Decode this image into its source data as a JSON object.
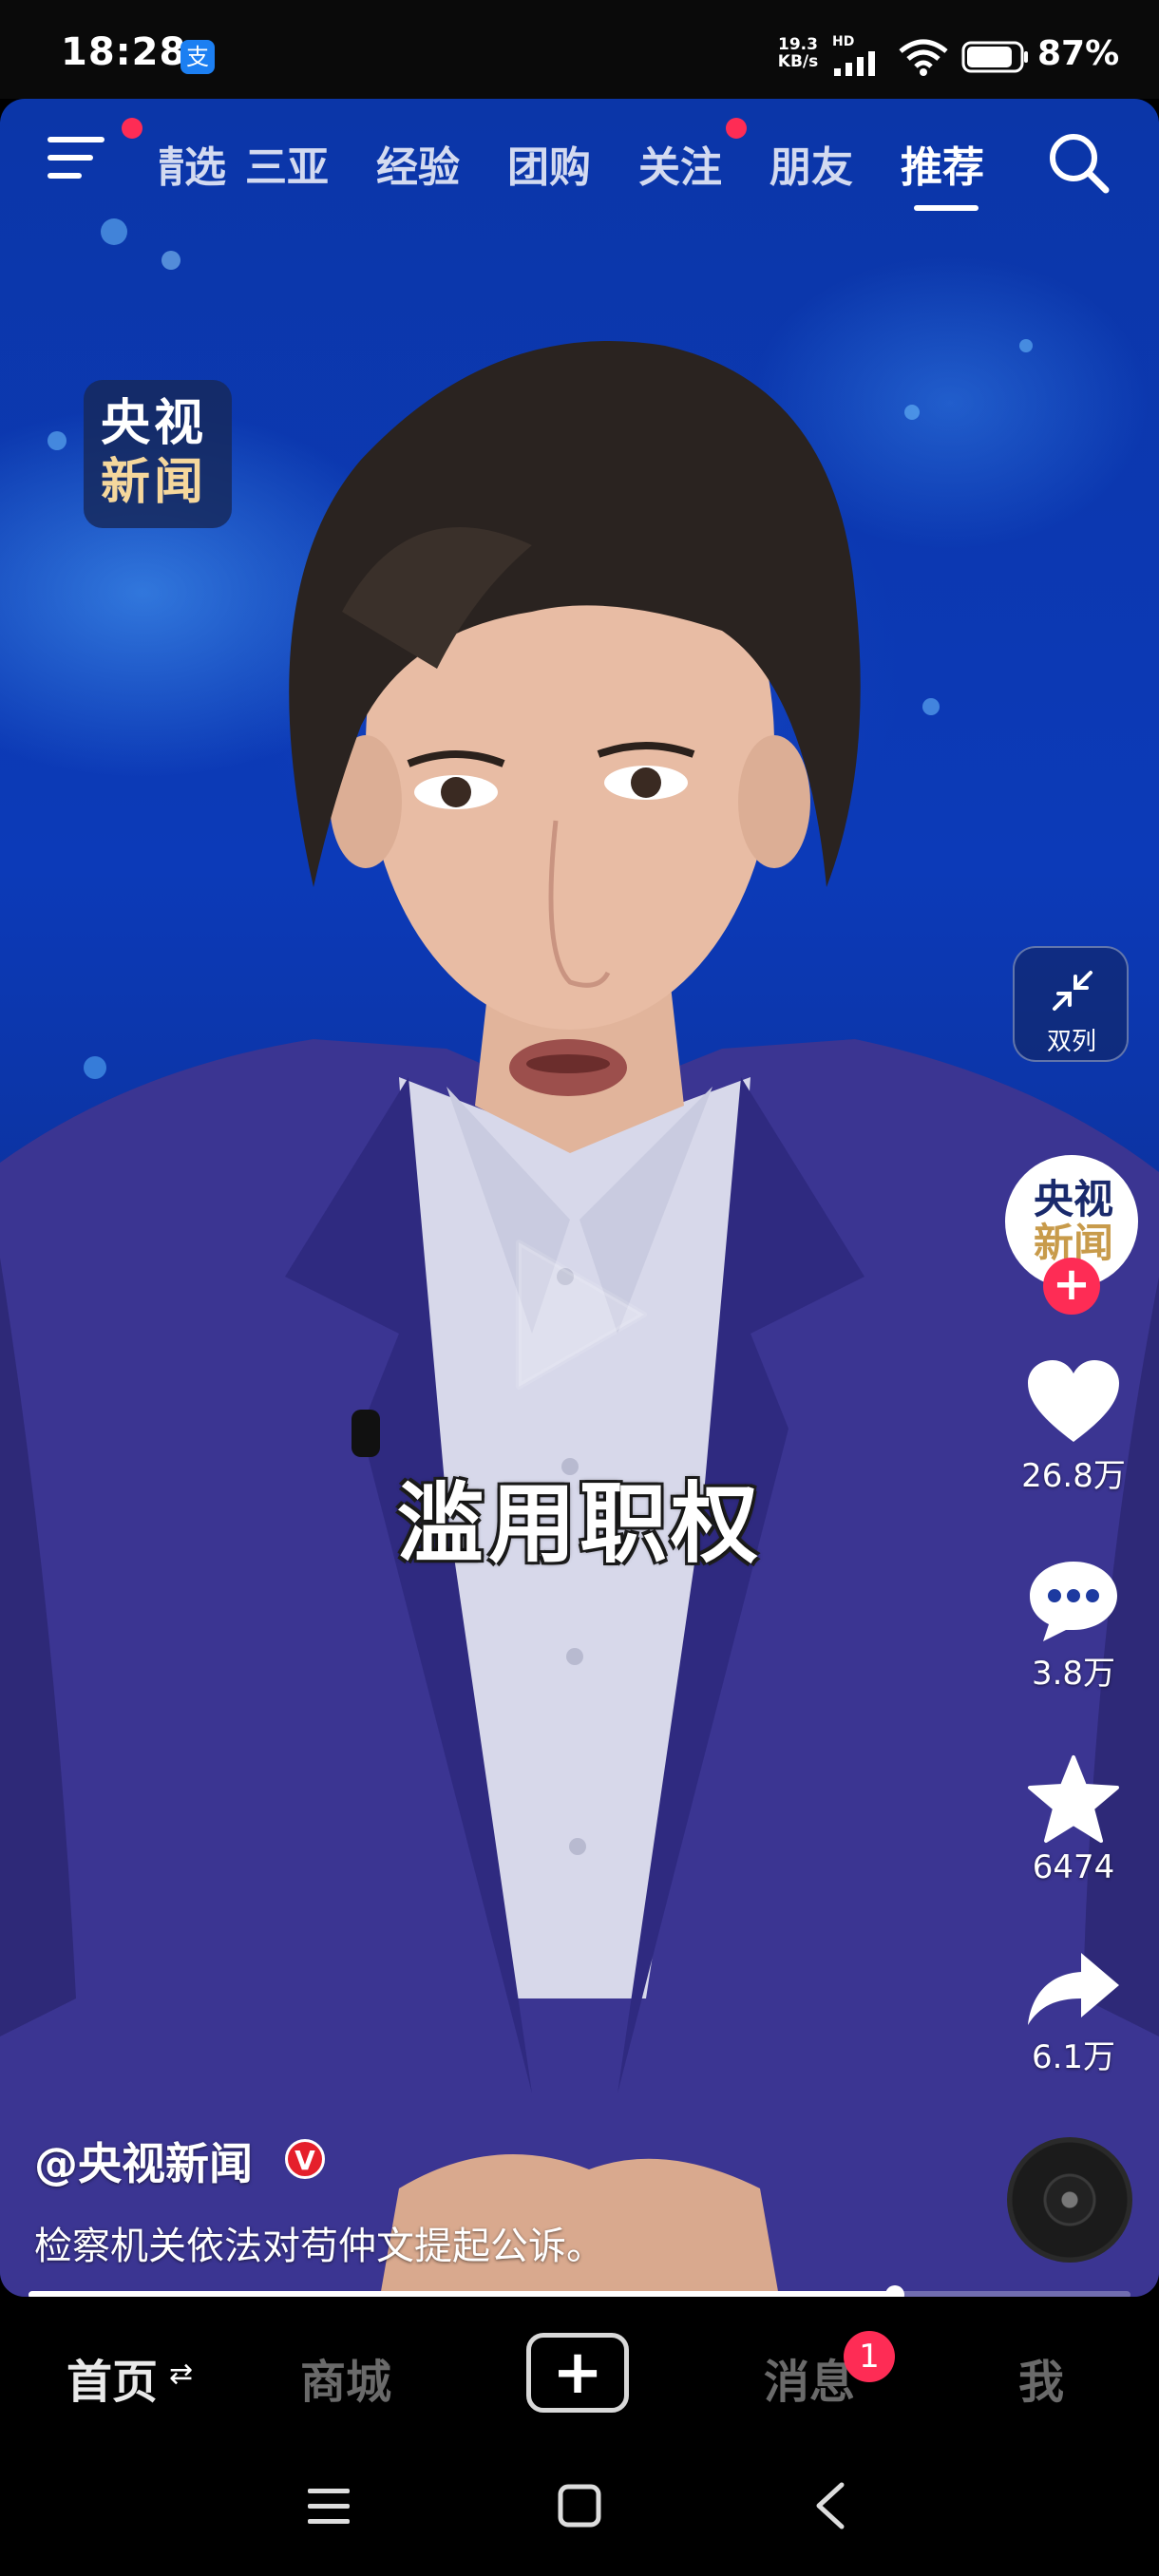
{
  "status_bar": {
    "time": "18:28",
    "app_icon_glyph": "支",
    "net_speed_value": "19.3",
    "net_speed_unit": "KB/s",
    "hd_label": "HD",
    "battery_percent": "87%",
    "battery_level": 0.87,
    "icons": [
      "alipay-icon",
      "signal-icon",
      "wifi-icon",
      "battery-icon"
    ]
  },
  "top_nav": {
    "tabs": [
      {
        "label": "精选"
      },
      {
        "label": "三亚"
      },
      {
        "label": "经验"
      },
      {
        "label": "团购"
      },
      {
        "label": "关注"
      },
      {
        "label": "朋友"
      },
      {
        "label": "推荐"
      }
    ],
    "active_tab": "推荐",
    "badge_color": "#fe2c55"
  },
  "video": {
    "watermark_line1": "央视",
    "watermark_line2": "新闻",
    "subtitle": "滥用职权",
    "progress": 0.786
  },
  "right_rail": {
    "dual_column_label": "双列",
    "avatar_line1": "央视",
    "avatar_line2": "新闻",
    "follow_plus": "+",
    "like_count": "26.8万",
    "comment_count": "3.8万",
    "favorite_count": "6474",
    "share_count": "6.1万"
  },
  "caption": {
    "author": "@央视新闻",
    "verified_mark": "V",
    "description": "检察机关依法对苟仲文提起公诉。"
  },
  "bottom_nav": {
    "home": "首页",
    "home_swap_glyph": "⇄",
    "mall": "商城",
    "add": "+",
    "messages": "消息",
    "messages_badge": "1",
    "me": "我"
  },
  "colors": {
    "accent": "#fe2c55",
    "verified": "#e5202b",
    "video_blue": "#0c3ab8"
  }
}
